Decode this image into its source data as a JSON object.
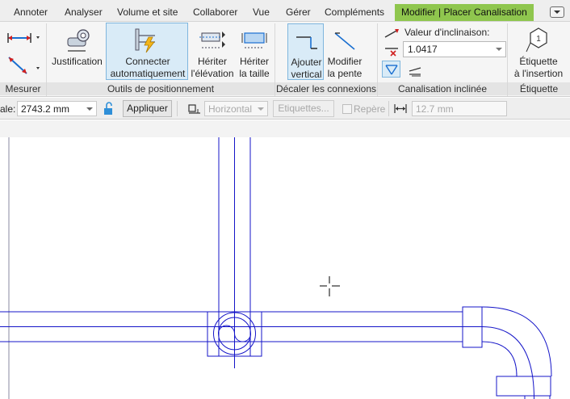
{
  "tabs": [
    {
      "label": "Annoter"
    },
    {
      "label": "Analyser"
    },
    {
      "label": "Volume et site"
    },
    {
      "label": "Collaborer"
    },
    {
      "label": "Vue"
    },
    {
      "label": "Gérer"
    },
    {
      "label": "Compléments"
    },
    {
      "label": "Modifier | Placer Canalisation",
      "active": true
    }
  ],
  "ribbon": {
    "mesurer": {
      "panel_label": "Mesurer"
    },
    "outils": {
      "panel_label": "Outils de positionnement",
      "justification": "Justification",
      "connecter_line1": "Connecter",
      "connecter_line2": "automatiquement",
      "heriter_elev_line1": "Hériter",
      "heriter_elev_line2": "l'élévation",
      "heriter_taille_line1": "Hériter",
      "heriter_taille_line2": "la taille"
    },
    "decaler": {
      "panel_label": "Décaler les connexions",
      "ajouter_line1": "Ajouter",
      "ajouter_line2": "vertical",
      "modifier_line1": "Modifier",
      "modifier_line2": "la pente"
    },
    "canalisation": {
      "panel_label": "Canalisation inclinée",
      "valeur_label": "Valeur d'inclinaison:",
      "valeur_value": "1.0417"
    },
    "etiquette": {
      "panel_label": "Étiquette",
      "line1": "Étiquette",
      "line2": "à l'insertion",
      "badge": "1"
    }
  },
  "options_bar": {
    "scale_label": "ale:",
    "scale_value": "2743.2 mm",
    "apply_button": "Appliquer",
    "orientation_value": "Horizontal",
    "etiquettes_button": "Etiquettes...",
    "repere_label": "Repère",
    "width_value": "12.7 mm"
  },
  "colors": {
    "active_tab": "#8fc64e",
    "selection": "#d9ebf7",
    "pipe_line": "#1414c8"
  }
}
